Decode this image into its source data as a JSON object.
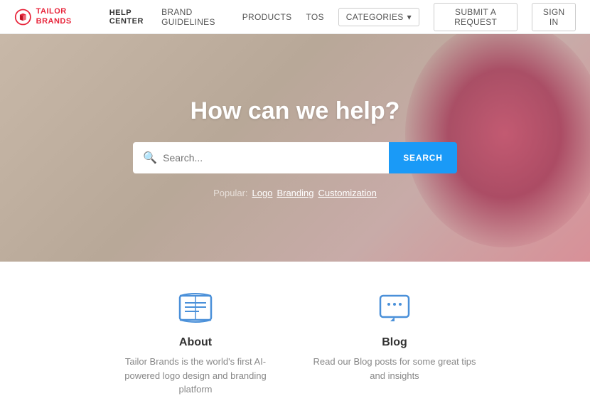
{
  "header": {
    "logo_brand": "TAILOR\nBRANDS",
    "help_center": "HELP CENTER",
    "nav": {
      "brand_guidelines": "BRAND GUIDELINES",
      "products": "PRODUCTS",
      "tos": "TOS",
      "categories": "CATEGORIES",
      "submit_request": "SUBMIT A REQUEST",
      "sign_in": "SIGN IN"
    }
  },
  "hero": {
    "title": "How can we help?",
    "search_placeholder": "Search...",
    "search_button": "SEARCH",
    "popular_label": "Popular:",
    "popular_links": [
      "Logo",
      "Branding",
      "Customization"
    ]
  },
  "cards": [
    {
      "id": "about",
      "title": "About",
      "description": "Tailor Brands is the world's first AI-powered logo design and branding platform"
    },
    {
      "id": "blog",
      "title": "Blog",
      "description": "Read our Blog posts for some great tips and insights"
    }
  ]
}
